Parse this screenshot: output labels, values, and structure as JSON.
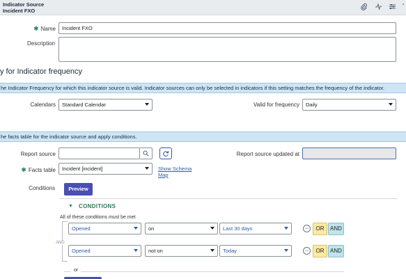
{
  "header": {
    "title_line1": "Indicator Source",
    "title_line2": "Incident FXO",
    "icons": [
      "paperclip-icon",
      "activity-icon",
      "settings-sliders-icon",
      "more-icon"
    ]
  },
  "form": {
    "name_label": "Name",
    "name_value": "Incident FXO",
    "description_label": "Description",
    "description_value": ""
  },
  "frequency_section": {
    "title": "y for Indicator frequency",
    "banner": "he Indicator Frequency for which this indicator source is valid. Indicator sources can only be selected in indicators if this setting matches the frequency of the indicator.",
    "calendars_label": "Calendars",
    "calendars_value": "Standard Calendar",
    "valid_label": "Valid for frequency",
    "valid_value": "Daily"
  },
  "facts_section": {
    "banner": "he facts table for the indicator source and apply conditions.",
    "report_source_label": "Report source",
    "report_source_value": "",
    "report_updated_label": "Report source updated at",
    "report_updated_value": "",
    "facts_table_label": "Facts table",
    "facts_table_value": "Incident [incident]",
    "show_schema_line1": "Show Schema",
    "show_schema_line2": "Map",
    "conditions_label": "Conditions",
    "preview_label": "Preview"
  },
  "conditions": {
    "header": "CONDITIONS",
    "must_be_met": "All of these conditions must be met",
    "and_connector": "AND",
    "rows": [
      {
        "field": "Opened",
        "operator": "on",
        "value": "Last 30 days",
        "or_label": "OR",
        "and_label": "AND"
      },
      {
        "field": "Opened",
        "operator": "not on",
        "value": "Today",
        "or_label": "OR",
        "and_label": "AND"
      }
    ],
    "or_divider": "or"
  },
  "colors": {
    "banner_bg": "#cfe5f5",
    "preview_bg": "#4a4fb5",
    "or_bg": "#fbe9a3",
    "and_bg": "#bfe4ec",
    "link": "#2d5aa6"
  }
}
